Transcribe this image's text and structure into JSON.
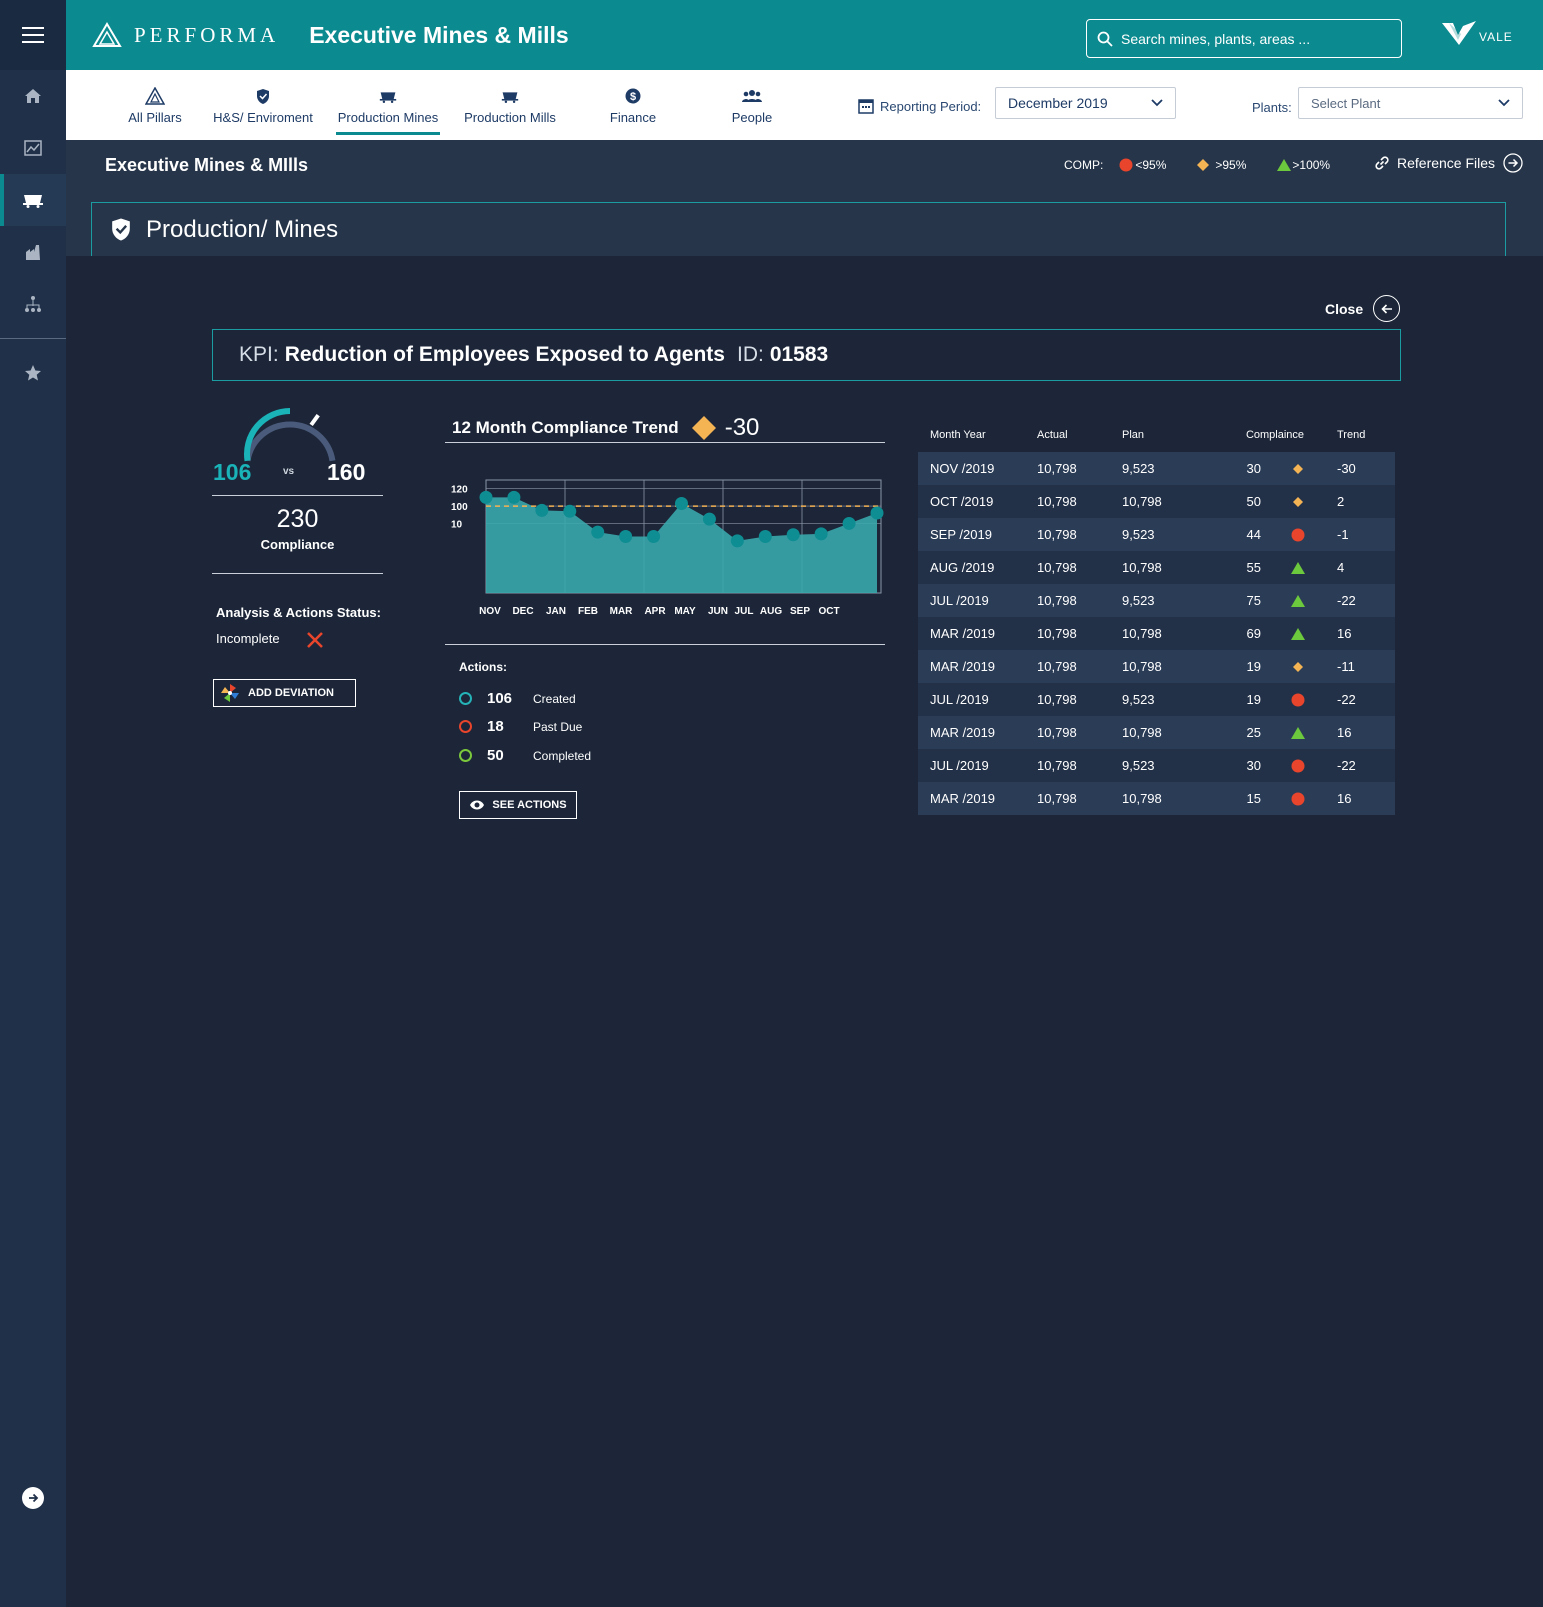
{
  "header": {
    "brand": "PERFORMA",
    "title": "Executive Mines & Mills",
    "search_placeholder": "Search mines, plants, areas ...",
    "logo_text": "VALE"
  },
  "nav": {
    "tabs": [
      {
        "label": "All Pillars",
        "icon": "pillars-icon"
      },
      {
        "label": "H&S/ Enviroment",
        "icon": "shield-icon"
      },
      {
        "label": "Production Mines",
        "icon": "mine-cart-icon",
        "active": true
      },
      {
        "label": "Production Mills",
        "icon": "mine-cart-icon"
      },
      {
        "label": "Finance",
        "icon": "dollar-icon"
      },
      {
        "label": "People",
        "icon": "people-icon"
      }
    ],
    "period_label": "Reporting Period:",
    "period_value": "December 2019",
    "plants_label": "Plants:",
    "plants_value": "Select Plant"
  },
  "subheader": {
    "title": "Executive Mines & MIlls",
    "comp_label": "COMP:",
    "legend": [
      {
        "label": "<95%",
        "shape": "circle",
        "color": "#e8452c"
      },
      {
        "label": ">95%",
        "shape": "diamond",
        "color": "#f5b454"
      },
      {
        "label": ">100%",
        "shape": "triangle",
        "color": "#6cc83c"
      }
    ],
    "reference_files": "Reference Files",
    "section": "Production/ Mines"
  },
  "close_label": "Close",
  "kpi": {
    "label": "KPI:",
    "name": "Reduction of Employees Exposed to Agents",
    "id_label": "ID:",
    "id": "01583"
  },
  "gauge": {
    "actual": "106",
    "vs": "vs",
    "plan": "160",
    "compliance": "230",
    "compliance_label": "Compliance",
    "fill_fraction": 0.5
  },
  "status": {
    "label": "Analysis & Actions Status:",
    "value": "Incomplete"
  },
  "add_deviation": "ADD DEVIATION",
  "trend": {
    "title": "12 Month Compliance Trend",
    "delta": "-30",
    "indicator_color": "#f5b454"
  },
  "chart_data": {
    "type": "area",
    "y_ticks": [
      "120",
      "100",
      "10"
    ],
    "x_labels": [
      "NOV",
      "DEC",
      "JAN",
      "FEB",
      "MAR",
      "APR",
      "MAY",
      "JUN",
      "JUL",
      "AUG",
      "SEP",
      "OCT"
    ],
    "values": [
      110,
      110,
      95,
      94,
      70,
      65,
      65,
      103,
      85,
      60,
      65,
      67,
      68,
      80,
      92
    ],
    "target": 100,
    "ylim": [
      0,
      130
    ],
    "fill_color": "#3aa8ad",
    "point_color": "#0e8e93",
    "target_color": "#f5b454"
  },
  "actions": {
    "title": "Actions:",
    "items": [
      {
        "num": "106",
        "label": "Created",
        "color": "#25b3b8"
      },
      {
        "num": "18",
        "label": "Past Due",
        "color": "#e8452c"
      },
      {
        "num": "50",
        "label": "Completed",
        "color": "#7cc83c"
      }
    ],
    "see_actions": "SEE ACTIONS"
  },
  "table": {
    "headers": [
      "Month Year",
      "Actual",
      "Plan",
      "Complaince",
      "Trend"
    ],
    "rows": [
      {
        "month": "NOV /2019",
        "actual": "10,798",
        "plan": "9,523",
        "comp": "30",
        "status": "diamond",
        "trend": "-30"
      },
      {
        "month": "OCT  /2019",
        "actual": "10,798",
        "plan": "10,798",
        "comp": "50",
        "status": "diamond",
        "trend": "2"
      },
      {
        "month": "SEP /2019",
        "actual": "10,798",
        "plan": "9,523",
        "comp": "44",
        "status": "circle",
        "trend": "-1"
      },
      {
        "month": "AUG /2019",
        "actual": "10,798",
        "plan": "10,798",
        "comp": "55",
        "status": "triangle",
        "trend": "4"
      },
      {
        "month": "JUL /2019",
        "actual": "10,798",
        "plan": "9,523",
        "comp": "75",
        "status": "triangle",
        "trend": "-22"
      },
      {
        "month": "MAR /2019",
        "actual": "10,798",
        "plan": "10,798",
        "comp": "69",
        "status": "triangle",
        "trend": "16"
      },
      {
        "month": "MAR /2019",
        "actual": "10,798",
        "plan": "10,798",
        "comp": "19",
        "status": "diamond",
        "trend": "-11"
      },
      {
        "month": "JUL /2019",
        "actual": "10,798",
        "plan": "9,523",
        "comp": "19",
        "status": "circle",
        "trend": "-22"
      },
      {
        "month": "MAR /2019",
        "actual": "10,798",
        "plan": "10,798",
        "comp": "25",
        "status": "triangle",
        "trend": "16"
      },
      {
        "month": "JUL /2019",
        "actual": "10,798",
        "plan": "9,523",
        "comp": "30",
        "status": "circle",
        "trend": "-22"
      },
      {
        "month": "MAR /2019",
        "actual": "10,798",
        "plan": "10,798",
        "comp": "15",
        "status": "circle",
        "trend": "16"
      }
    ]
  }
}
